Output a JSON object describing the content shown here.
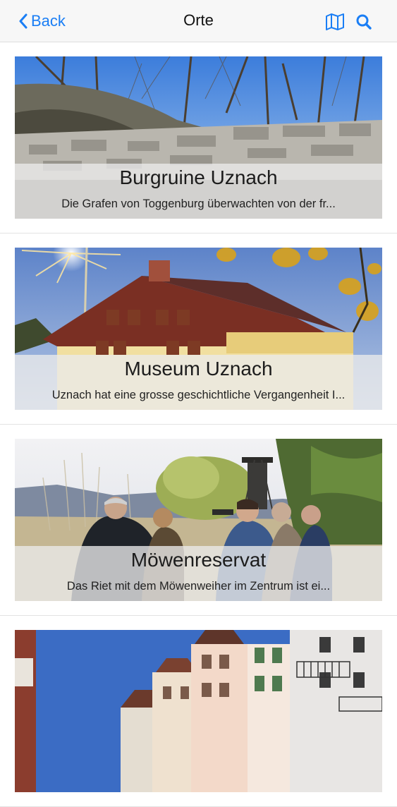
{
  "navbar": {
    "back_label": "Back",
    "title": "Orte",
    "icons": [
      "map-icon",
      "search-icon"
    ]
  },
  "places": [
    {
      "title": "Burgruine Uznach",
      "description": "Die Grafen von Toggenburg überwachten von der fr..."
    },
    {
      "title": "Museum Uznach",
      "description": "Uznach hat eine grosse geschichtliche Vergangenheit  I..."
    },
    {
      "title": "Möwenreservat",
      "description": "Das Riet mit dem Möwenweiher im Zentrum ist ei..."
    }
  ],
  "colors": {
    "accent": "#1a7ef5",
    "navbar_bg": "#f7f7f7",
    "caption_overlay": "rgba(235,235,235,0.78)"
  }
}
